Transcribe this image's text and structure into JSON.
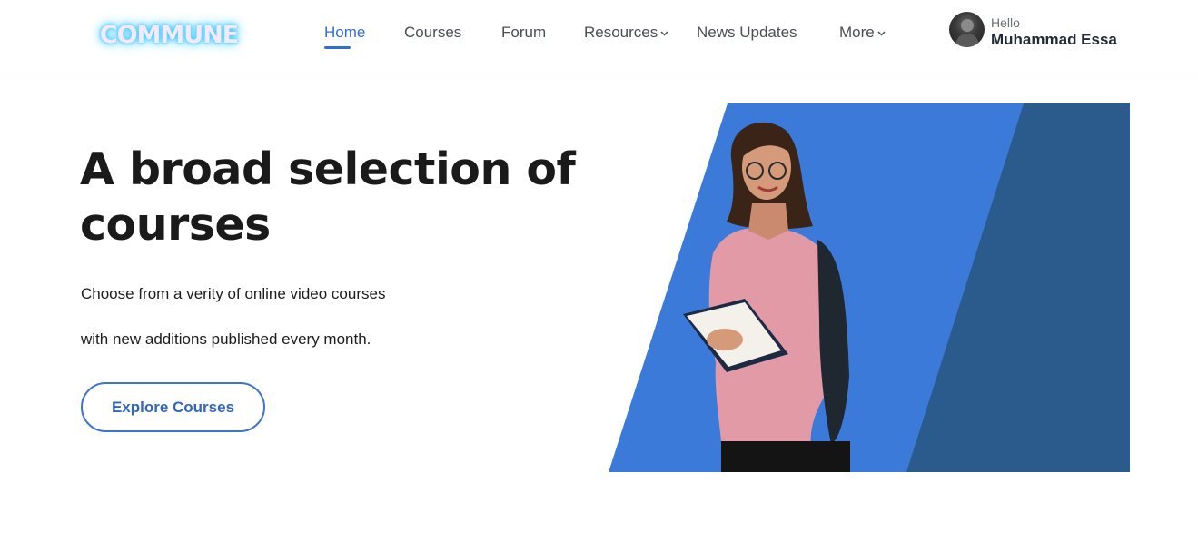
{
  "header": {
    "logo_text": "COMMUNE",
    "nav": [
      {
        "label": "Home"
      },
      {
        "label": "Courses"
      },
      {
        "label": "Forum"
      },
      {
        "label": "Resources"
      },
      {
        "label": "News Updates"
      },
      {
        "label": "More"
      }
    ],
    "user": {
      "greeting": "Hello",
      "name": "Muhammad Essa"
    }
  },
  "hero": {
    "title": "A broad selection of courses",
    "lines": [
      "Choose from a verity of online video courses",
      "with new additions published every month."
    ],
    "cta_label": "Explore Courses"
  },
  "theme": {
    "accent": "#2e6fd6",
    "panel_blue": "#3b7ad8",
    "panel_dark": "#2b5b8c"
  }
}
